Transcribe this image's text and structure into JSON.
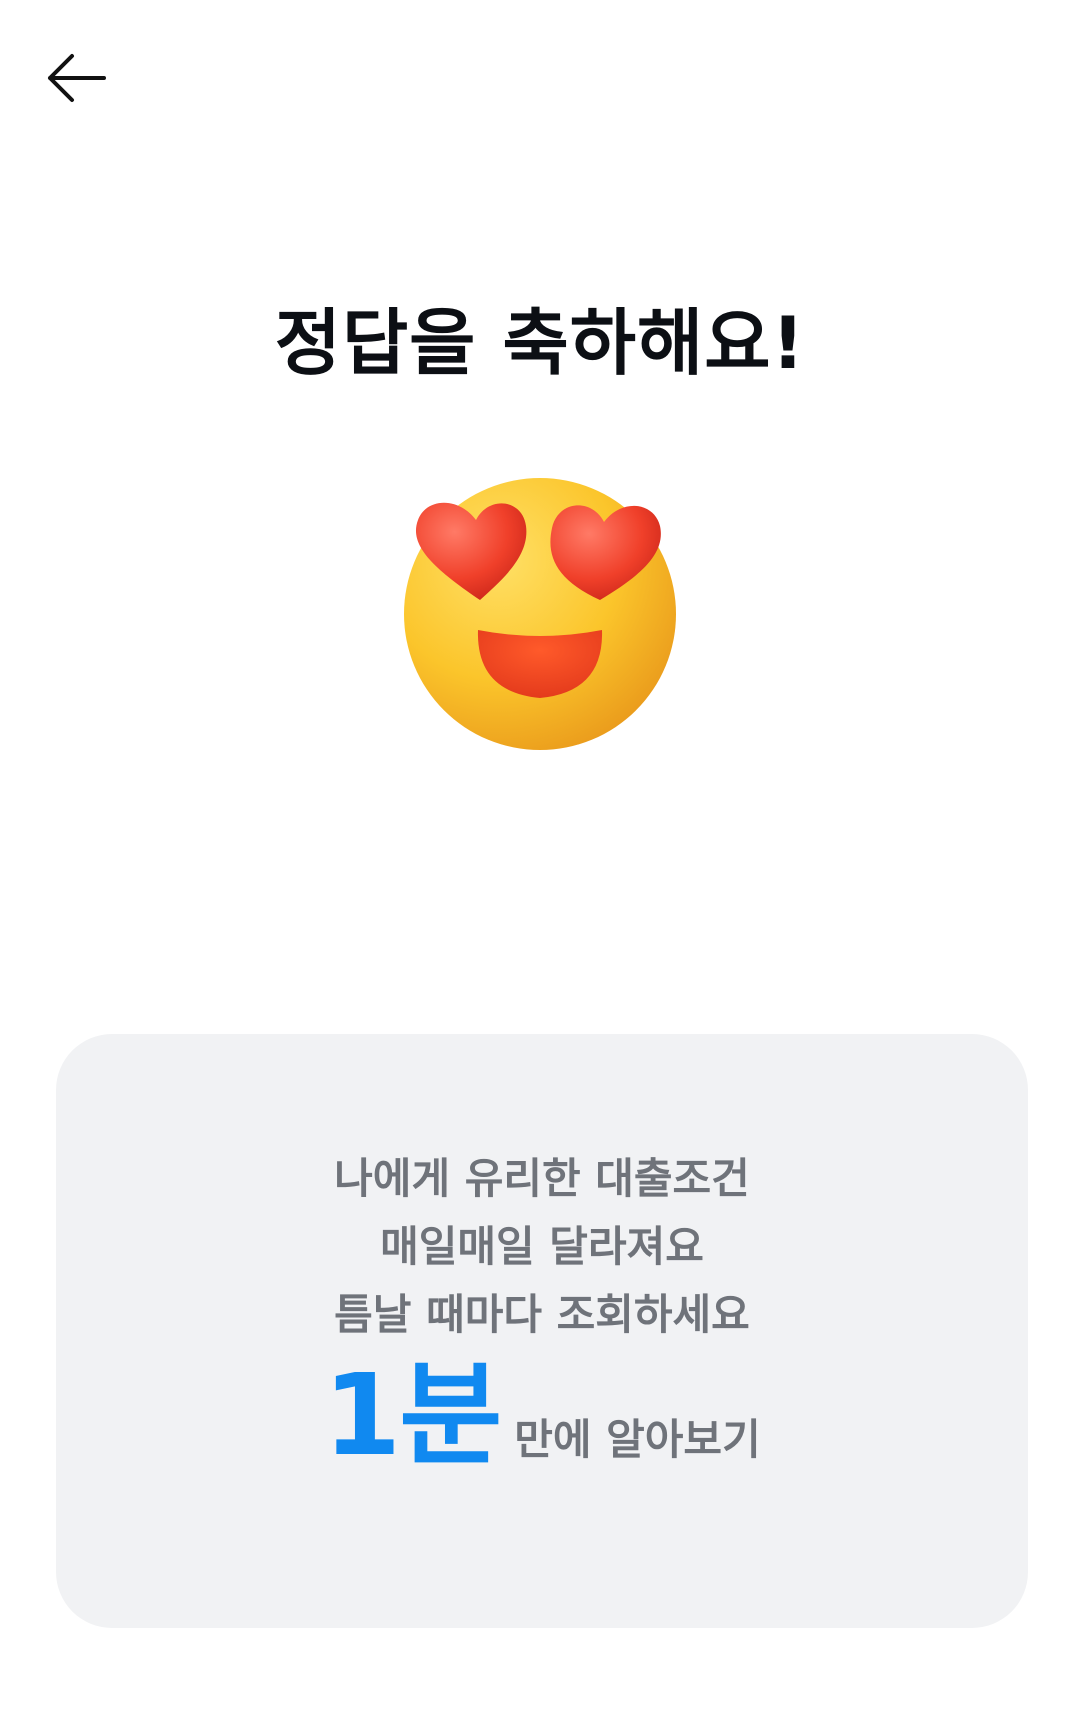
{
  "header": {
    "back_icon": "arrow-left-icon"
  },
  "main": {
    "title": "정답을 축하해요!",
    "emoji": "heart-eyes-emoji"
  },
  "card": {
    "lines": [
      "나에게 유리한 대출조건",
      "매일매일 달라져요",
      "틈날 때마다 조회하세요"
    ],
    "cta_highlight": "1분",
    "cta_rest": "만에 알아보기"
  },
  "colors": {
    "accent": "#1089f0",
    "card_bg": "#f1f2f4",
    "title_text": "#0c0f14",
    "body_text": "#6f737a"
  }
}
